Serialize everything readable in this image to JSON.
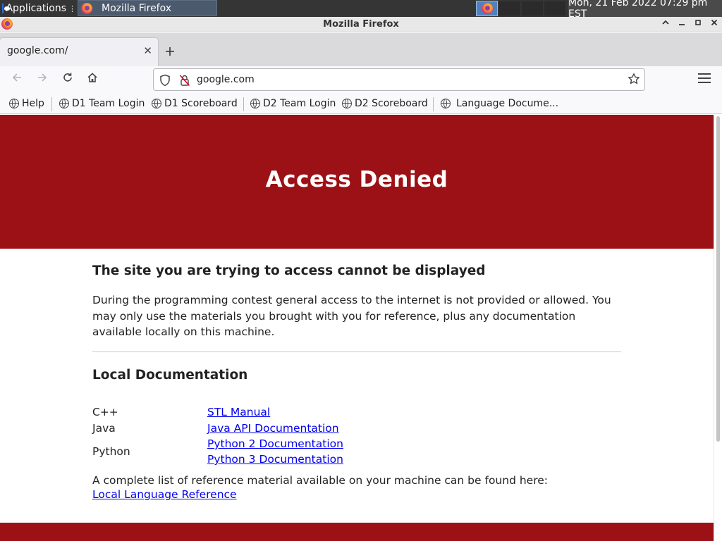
{
  "desktop": {
    "applications_label": "Applications",
    "taskbar_window_title": "Mozilla Firefox",
    "clock": "Mon, 21 Feb 2022 07:29 pm EST"
  },
  "window": {
    "title": "Mozilla Firefox"
  },
  "tabs": [
    {
      "label": "google.com/"
    }
  ],
  "navigation": {
    "url": "google.com"
  },
  "bookmarks": [
    {
      "label": "Help"
    },
    {
      "label": "D1 Team Login"
    },
    {
      "label": "D1 Scoreboard"
    },
    {
      "label": "D2 Team Login"
    },
    {
      "label": "D2 Scoreboard"
    },
    {
      "label": "Language Docume..."
    }
  ],
  "page": {
    "banner_title": "Access Denied",
    "heading": "The site you are trying to access cannot be displayed",
    "intro": "During the programming contest general access to the internet is not provided or allowed. You may only use the materials you brought with you for reference, plus any documentation available locally on this machine.",
    "docs_heading": "Local Documentation",
    "docs": [
      {
        "language": "C++",
        "links": [
          "STL Manual"
        ]
      },
      {
        "language": "Java",
        "links": [
          "Java API Documentation"
        ]
      },
      {
        "language": "Python",
        "links": [
          "Python 2 Documentation",
          "Python 3 Documentation"
        ]
      }
    ],
    "complete_list_text": "A complete list of reference material available on your machine can be found here:",
    "reference_link": "Local Language Reference"
  },
  "colors": {
    "banner": "#9c1115",
    "link": "#0000ee"
  }
}
